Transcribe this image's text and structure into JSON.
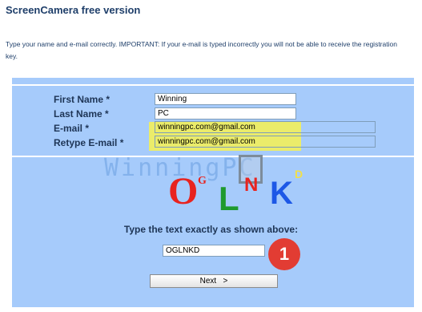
{
  "page": {
    "title": "ScreenCamera free version",
    "intro": "Type your name and e-mail correctly. IMPORTANT: If your e-mail is typed incorrectly you will not be able to receive the registration key."
  },
  "form": {
    "first_name": {
      "label": "First Name *",
      "value": "Winning"
    },
    "last_name": {
      "label": "Last Name *",
      "value": "PC"
    },
    "email": {
      "label": "E-mail *",
      "value": "winningpc.com@gmail.com"
    },
    "retype_email": {
      "label": "Retype E-mail *",
      "value": "winningpc.com@gmail.com"
    }
  },
  "captcha": {
    "watermark": "WinningPC",
    "letters": [
      "O",
      "G",
      "L",
      "N",
      "K",
      "D"
    ],
    "letter_colors": [
      "#e8231f",
      "#e8231f",
      "#1f9a2e",
      "#e8231f",
      "#1d58e6",
      "#f1e04a"
    ],
    "instruction": "Type the text exactly as shown above:",
    "input_value": "OGLNKD"
  },
  "annotation": {
    "badge": "1"
  },
  "buttons": {
    "next": "Next   >"
  },
  "colors": {
    "panel": "#a6cbfb",
    "highlight": "#f3f05a",
    "badge": "#e23c33"
  }
}
